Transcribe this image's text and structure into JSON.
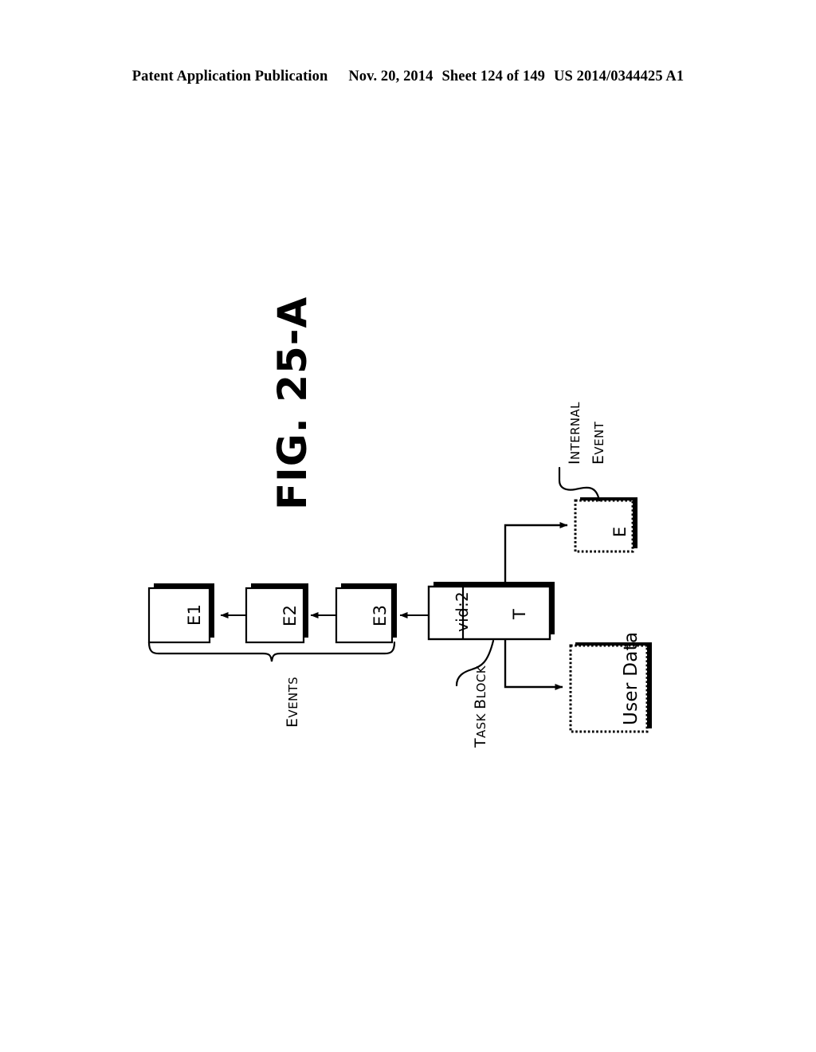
{
  "header": {
    "publication": "Patent Application Publication",
    "date": "Nov. 20, 2014",
    "sheet": "Sheet 124 of 149",
    "patent_number": "US 2014/0344425 A1"
  },
  "figure": {
    "title_main": "F",
    "title_rest": "IG. 25-A",
    "title_full": "FIG. 25-A"
  },
  "diagram": {
    "event_boxes": [
      {
        "id": "e1",
        "label": "E1"
      },
      {
        "id": "e2",
        "label": "E2"
      },
      {
        "id": "e3",
        "label": "E3"
      }
    ],
    "task_block": {
      "vid_label": "vid:2",
      "task_label": "T"
    },
    "internal_event_box": {
      "label": "E"
    },
    "user_data_box": {
      "label": "User Data"
    },
    "annotations": {
      "events": {
        "first": "E",
        "rest": "VENTS"
      },
      "task_block": {
        "first_a": "T",
        "rest_a": "ASK ",
        "first_b": "B",
        "rest_b": "LOCK"
      },
      "internal": {
        "first": "I",
        "rest": "NTERNAL"
      },
      "event": {
        "first": "E",
        "rest": "VENT"
      }
    }
  },
  "colors": {
    "ink": "#000000",
    "paper": "#ffffff"
  }
}
